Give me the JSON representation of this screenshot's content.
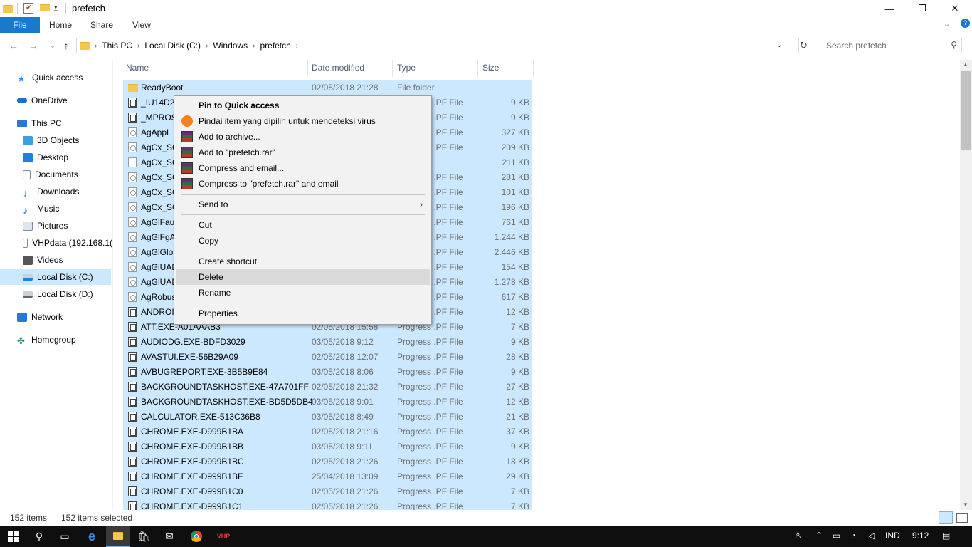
{
  "window": {
    "title": "prefetch",
    "minimize_glyph": "—",
    "maximize_glyph": "❐",
    "close_glyph": "✕"
  },
  "ribbon": {
    "tabs": [
      "File",
      "Home",
      "Share",
      "View"
    ]
  },
  "address": {
    "crumbs": [
      "This PC",
      "Local Disk (C:)",
      "Windows",
      "prefetch"
    ],
    "search_placeholder": "Search prefetch"
  },
  "sidebar": {
    "items": [
      {
        "label": "Quick access",
        "icon": "star-icon",
        "color": "#1e90ff"
      },
      {
        "label": "OneDrive",
        "icon": "cloud-icon",
        "color": "#1e6fc9"
      },
      {
        "label": "This PC",
        "icon": "computer-icon",
        "color": "#2b78d2"
      },
      {
        "label": "3D Objects",
        "icon": "cube-icon",
        "color": "#3aa0e0"
      },
      {
        "label": "Desktop",
        "icon": "desktop-icon",
        "color": "#1e80e0"
      },
      {
        "label": "Documents",
        "icon": "document-icon",
        "color": "#7d8da6"
      },
      {
        "label": "Downloads",
        "icon": "download-arrow-icon",
        "color": "#2b78d2"
      },
      {
        "label": "Music",
        "icon": "music-note-icon",
        "color": "#2b78d2"
      },
      {
        "label": "Pictures",
        "icon": "picture-icon",
        "color": "#7d8da6"
      },
      {
        "label": "VHPdata (192.168.1(",
        "icon": "network-drive-icon",
        "color": "#7d8da6"
      },
      {
        "label": "Videos",
        "icon": "film-icon",
        "color": "#555555"
      },
      {
        "label": "Local Disk (C:)",
        "icon": "drive-icon",
        "color": "#1e80e0"
      },
      {
        "label": "Local Disk (D:)",
        "icon": "drive-icon",
        "color": "#666666"
      },
      {
        "label": "Network",
        "icon": "network-icon",
        "color": "#2b78d2"
      },
      {
        "label": "Homegroup",
        "icon": "homegroup-icon",
        "color": "#2e8b57"
      }
    ]
  },
  "columns": [
    "Name",
    "Date modified",
    "Type",
    "Size"
  ],
  "files": [
    {
      "name": "ReadyBoot",
      "date": "02/05/2018 21:28",
      "type": "File folder",
      "size": "",
      "icon": "folder"
    },
    {
      "name": "_IU14D2N",
      "date": "",
      "type": "Progress .PF File",
      "size": "9 KB",
      "icon": "pf"
    },
    {
      "name": "_MPROS",
      "date": "",
      "type": "Progress .PF File",
      "size": "9 KB",
      "icon": "pf"
    },
    {
      "name": "AgAppL",
      "date": "",
      "type": "Progress .PF File",
      "size": "327 KB",
      "icon": "gear"
    },
    {
      "name": "AgCx_SC",
      "date": "",
      "type": "Progress .PF File",
      "size": "209 KB",
      "icon": "gear"
    },
    {
      "name": "AgCx_SC",
      "date": "",
      "type": "",
      "size": "211 KB",
      "icon": "blank"
    },
    {
      "name": "AgCx_SC",
      "date": "",
      "type": "Progress .PF File",
      "size": "281 KB",
      "icon": "gear"
    },
    {
      "name": "AgCx_SC",
      "date": "",
      "type": "Progress .PF File",
      "size": "101 KB",
      "icon": "gear"
    },
    {
      "name": "AgCx_SC",
      "date": "",
      "type": "Progress .PF File",
      "size": "196 KB",
      "icon": "gear"
    },
    {
      "name": "AgGlFau",
      "date": "",
      "type": "Progress .PF File",
      "size": "761 KB",
      "icon": "gear"
    },
    {
      "name": "AgGlFgA",
      "date": "",
      "type": "Progress .PF File",
      "size": "1.244 KB",
      "icon": "gear"
    },
    {
      "name": "AgGlGlo",
      "date": "",
      "type": "Progress .PF File",
      "size": "2.446 KB",
      "icon": "gear"
    },
    {
      "name": "AgGlUAD",
      "date": "",
      "type": "Progress .PF File",
      "size": "154 KB",
      "icon": "gear"
    },
    {
      "name": "AgGlUAD",
      "date": "",
      "type": "Progress .PF File",
      "size": "1.278 KB",
      "icon": "gear"
    },
    {
      "name": "AgRobus",
      "date": "",
      "type": "Progress .PF File",
      "size": "617 KB",
      "icon": "gear"
    },
    {
      "name": "ANDROI",
      "date": "",
      "type": "Progress .PF File",
      "size": "12 KB",
      "icon": "pf"
    },
    {
      "name": "ATT.EXE-A01AAAB3",
      "date": "02/05/2018 15:58",
      "type": "Progress .PF File",
      "size": "7 KB",
      "icon": "pf"
    },
    {
      "name": "AUDIODG.EXE-BDFD3029",
      "date": "03/05/2018 9:12",
      "type": "Progress .PF File",
      "size": "9 KB",
      "icon": "pf"
    },
    {
      "name": "AVASTUI.EXE-56B29A09",
      "date": "02/05/2018 12:07",
      "type": "Progress .PF File",
      "size": "28 KB",
      "icon": "pf"
    },
    {
      "name": "AVBUGREPORT.EXE-3B5B9E84",
      "date": "03/05/2018 8:06",
      "type": "Progress .PF File",
      "size": "9 KB",
      "icon": "pf"
    },
    {
      "name": "BACKGROUNDTASKHOST.EXE-47A701FF",
      "date": "02/05/2018 21:32",
      "type": "Progress .PF File",
      "size": "27 KB",
      "icon": "pf"
    },
    {
      "name": "BACKGROUNDTASKHOST.EXE-BD5D5DB4",
      "date": "03/05/2018 9:01",
      "type": "Progress .PF File",
      "size": "12 KB",
      "icon": "pf"
    },
    {
      "name": "CALCULATOR.EXE-513C36B8",
      "date": "03/05/2018 8:49",
      "type": "Progress .PF File",
      "size": "21 KB",
      "icon": "pf"
    },
    {
      "name": "CHROME.EXE-D999B1BA",
      "date": "02/05/2018 21:16",
      "type": "Progress .PF File",
      "size": "37 KB",
      "icon": "pf"
    },
    {
      "name": "CHROME.EXE-D999B1BB",
      "date": "03/05/2018 9:11",
      "type": "Progress .PF File",
      "size": "9 KB",
      "icon": "pf"
    },
    {
      "name": "CHROME.EXE-D999B1BC",
      "date": "02/05/2018 21:26",
      "type": "Progress .PF File",
      "size": "18 KB",
      "icon": "pf"
    },
    {
      "name": "CHROME.EXE-D999B1BF",
      "date": "25/04/2018 13:09",
      "type": "Progress .PF File",
      "size": "29 KB",
      "icon": "pf"
    },
    {
      "name": "CHROME.EXE-D999B1C0",
      "date": "02/05/2018 21:26",
      "type": "Progress .PF File",
      "size": "7 KB",
      "icon": "pf"
    },
    {
      "name": "CHROME.EXE-D999B1C1",
      "date": "02/05/2018 21:26",
      "type": "Progress .PF File",
      "size": "7 KB",
      "icon": "pf"
    }
  ],
  "status": {
    "items": "152 items",
    "selected": "152 items selected"
  },
  "context_menu": {
    "pin": "Pin to Quick access",
    "scan": "Pindai item yang dipilih untuk mendeteksi virus",
    "add_archive": "Add to archive...",
    "add_rar": "Add to \"prefetch.rar\"",
    "compress_email": "Compress and email...",
    "compress_rar_email": "Compress to \"prefetch.rar\" and email",
    "send_to": "Send to",
    "cut": "Cut",
    "copy": "Copy",
    "create_shortcut": "Create shortcut",
    "delete": "Delete",
    "rename": "Rename",
    "properties": "Properties"
  },
  "taskbar": {
    "lang": "IND",
    "time": "9:12"
  }
}
